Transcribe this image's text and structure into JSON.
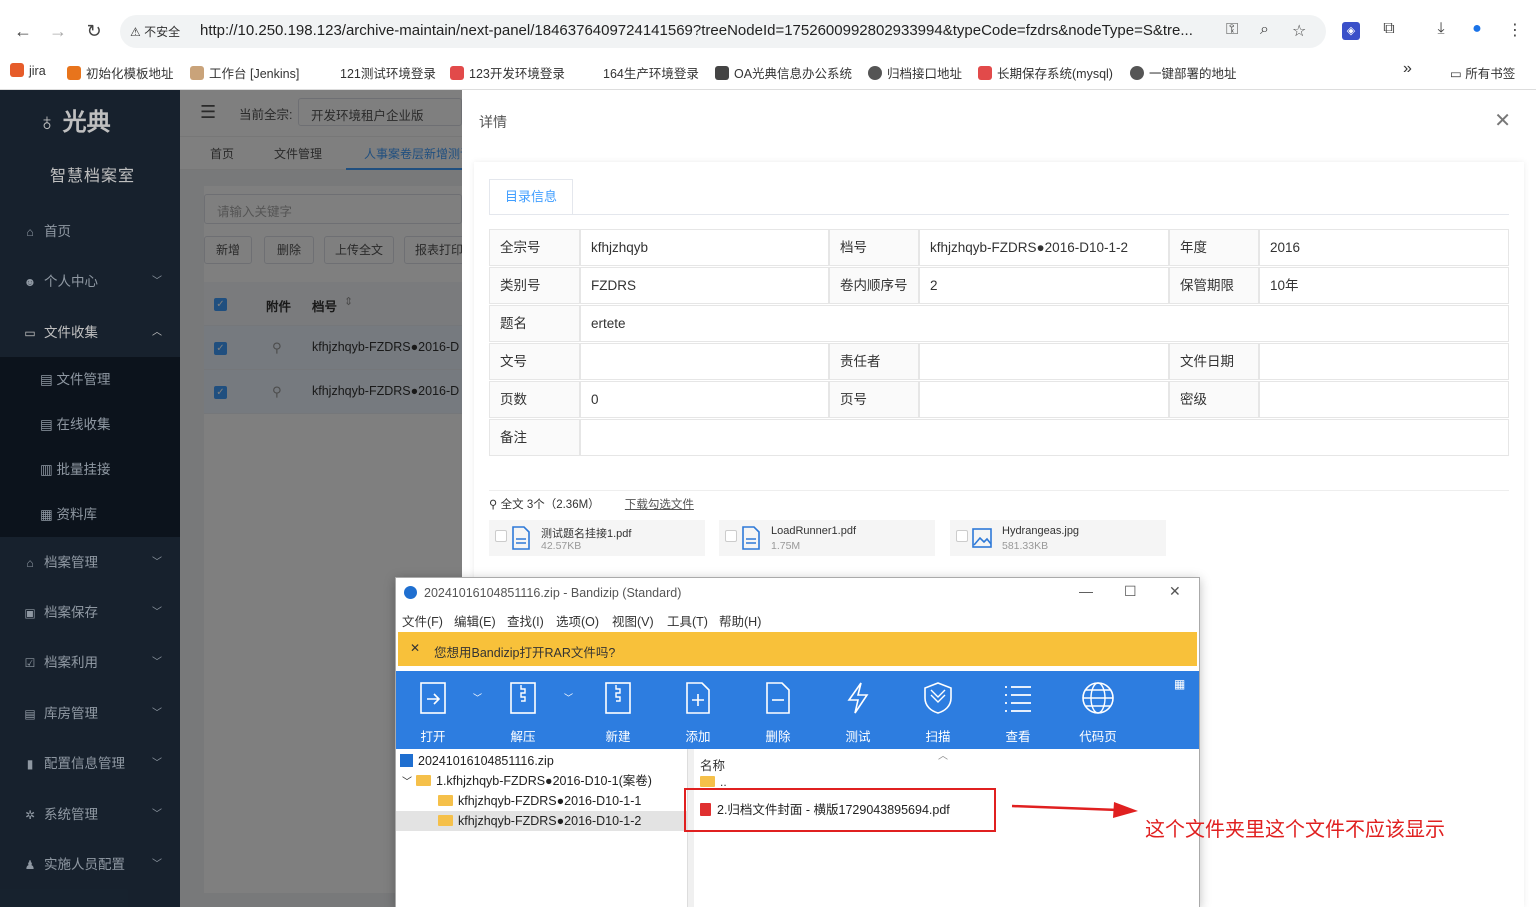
{
  "browser": {
    "security_label": "不安全",
    "url": "http://10.250.198.123/archive-maintain/next-panel/1846376409724141569?treeNodeId=1752600992802933994&typeCode=fzdrs&nodeType=S&tre...",
    "bookmarks": [
      "jira",
      "初始化模板地址",
      "工作台 [Jenkins]",
      "121测试环境登录",
      "123开发环境登录",
      "164生产环境登录",
      "OA光典信息办公系统",
      "归档接口地址",
      "长期保存系统(mysql)",
      "一键部署的地址"
    ],
    "all_bookmarks": "所有书签",
    "more": "»"
  },
  "sidebar": {
    "logo": "光典",
    "subtitle": "智慧档案室",
    "items": [
      {
        "label": "首页",
        "icon": "home-icon"
      },
      {
        "label": "个人中心",
        "icon": "user-icon"
      },
      {
        "label": "文件收集",
        "icon": "folder-icon"
      },
      {
        "label": "档案管理",
        "icon": "bank-icon"
      },
      {
        "label": "档案保存",
        "icon": "save-icon"
      },
      {
        "label": "档案利用",
        "icon": "check-icon"
      },
      {
        "label": "库房管理",
        "icon": "warehouse-icon"
      },
      {
        "label": "配置信息管理",
        "icon": "config-icon"
      },
      {
        "label": "系统管理",
        "icon": "gear-icon"
      },
      {
        "label": "实施人员配置",
        "icon": "team-icon"
      }
    ],
    "subitems": [
      "文件管理",
      "在线收集",
      "批量挂接",
      "资料库"
    ]
  },
  "app": {
    "fonds_label": "当前全宗:",
    "fonds_value": "开发环境租户企业版",
    "tabs": [
      "首页",
      "文件管理",
      "人事案卷层新增测试"
    ],
    "search_placeholder": "请输入关键字",
    "buttons": [
      "新增",
      "删除",
      "上传全文",
      "报表打印"
    ],
    "table_headers": [
      "附件",
      "档号"
    ],
    "rows": [
      "kfhjzhqyb-FZDRS●2016-D",
      "kfhjzhqyb-FZDRS●2016-D"
    ]
  },
  "drawer": {
    "title": "详情",
    "tab": "目录信息",
    "fields": {
      "l1": "全宗号",
      "v1": "kfhjzhqyb",
      "l2": "档号",
      "v2": "kfhjzhqyb-FZDRS●2016-D10-1-2",
      "l3": "年度",
      "v3": "2016",
      "l4": "类别号",
      "v4": "FZDRS",
      "l5": "卷内顺序号",
      "v5": "2",
      "l6": "保管期限",
      "v6": "10年",
      "l7": "题名",
      "v7": "ertete",
      "l8": "文号",
      "v8": "",
      "l9": "责任者",
      "v9": "",
      "l10": "文件日期",
      "v10": "",
      "l11": "页数",
      "v11": "0",
      "l12": "页号",
      "v12": "",
      "l13": "密级",
      "v13": "",
      "l14": "备注",
      "v14": ""
    },
    "attach_summary": "全文 3个（2.36M）",
    "download_link": "下载勾选文件",
    "files": [
      {
        "name": "测试题名挂接1.pdf",
        "size": "42.57KB"
      },
      {
        "name": "LoadRunner1.pdf",
        "size": "1.75M"
      },
      {
        "name": "Hydrangeas.jpg",
        "size": "581.33KB"
      }
    ]
  },
  "bandizip": {
    "title": "20241016104851116.zip - Bandizip (Standard)",
    "menu": [
      "文件(F)",
      "编辑(E)",
      "查找(I)",
      "选项(O)",
      "视图(V)",
      "工具(T)",
      "帮助(H)"
    ],
    "banner": "您想用Bandizip打开RAR文件吗?",
    "tools": [
      "打开",
      "解压",
      "新建",
      "添加",
      "删除",
      "测试",
      "扫描",
      "查看",
      "代码页"
    ],
    "tree": [
      "20241016104851116.zip",
      "1.kfhjzhqyb-FZDRS●2016-D10-1(案卷)",
      "kfhjzhqyb-FZDRS●2016-D10-1-1",
      "kfhjzhqyb-FZDRS●2016-D10-1-2"
    ],
    "list_header": "名称",
    "list_up": "..",
    "file": "2.归档文件封面 - 横版1729043895694.pdf"
  },
  "annotation": "这个文件夹里这个文件不应该显示"
}
